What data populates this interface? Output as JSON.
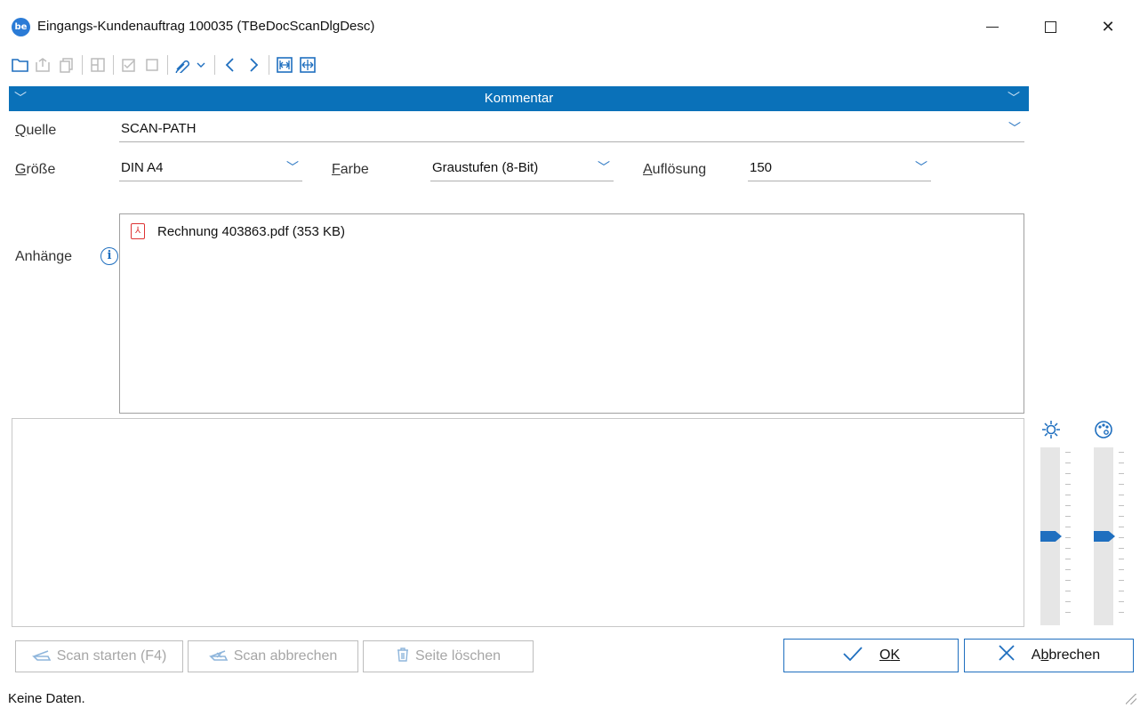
{
  "window": {
    "app_icon_text": "be",
    "title": "Eingangs-Kundenauftrag 100035 (TBeDocScanDlgDesc)"
  },
  "section": {
    "title": "Kommentar"
  },
  "form": {
    "quelle": {
      "label_first": "Q",
      "label_rest": "uelle",
      "value": "SCAN-PATH"
    },
    "groesse": {
      "label_first": "G",
      "label_rest": "röße",
      "value": "DIN A4"
    },
    "farbe": {
      "label_first": "F",
      "label_rest": "arbe",
      "value": "Graustufen (8-Bit)"
    },
    "aufloesung": {
      "label_first": "A",
      "label_rest": "uflösung",
      "value": "150"
    },
    "anhaenge_label": "Anhänge"
  },
  "attachments": [
    {
      "name": "Rechnung 403863.pdf (353 KB)"
    }
  ],
  "sliders": {
    "brightness_icon": "brightness-icon",
    "color_icon": "palette-icon",
    "brightness_level": 0.5,
    "contrast_level": 0.5
  },
  "buttons": {
    "scan_start": "Scan starten (F4)",
    "scan_cancel": "Scan abbrechen",
    "delete_page": "Seite löschen",
    "ok_first": "O",
    "ok_rest": "K",
    "cancel_first": "A",
    "cancel_under": "b",
    "cancel_rest": "brechen"
  },
  "status": {
    "text": "Keine Daten."
  },
  "colors": {
    "accent": "#0a71b9",
    "icon_blue": "#1f6fbf"
  }
}
